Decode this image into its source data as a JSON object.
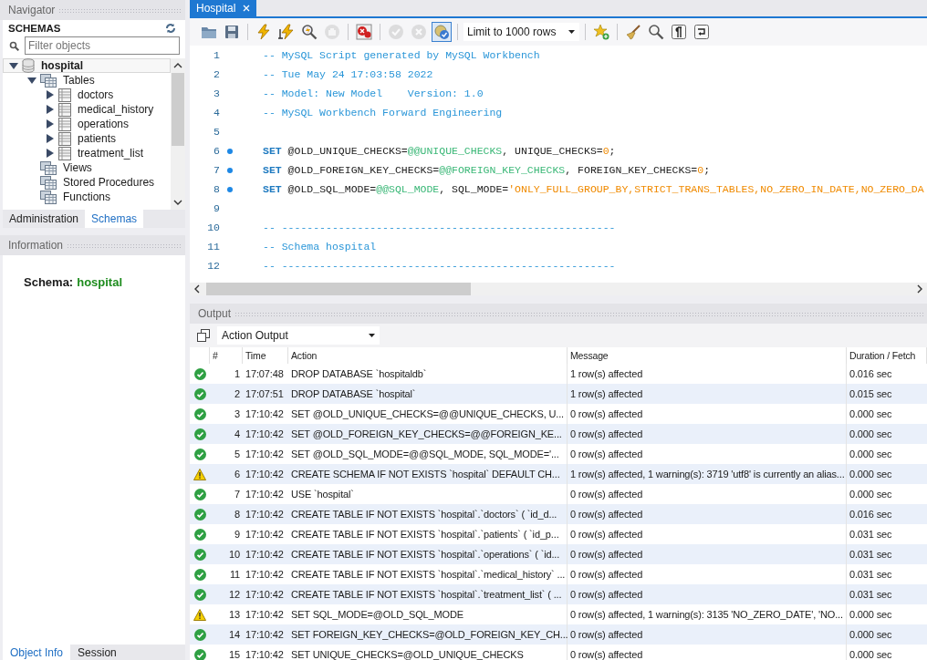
{
  "navigator": {
    "title": "Navigator",
    "section": "SCHEMAS",
    "filter": {
      "placeholder": "Filter objects"
    },
    "tree": [
      {
        "label": "hospital",
        "kind": "database",
        "expanded": true,
        "selected": true,
        "children": [
          {
            "label": "Tables",
            "kind": "folder",
            "expanded": true,
            "selected": false,
            "children": [
              {
                "label": "doctors",
                "kind": "table",
                "expanded": false,
                "selected": false
              },
              {
                "label": "medical_history",
                "kind": "table",
                "expanded": false,
                "selected": false
              },
              {
                "label": "operations",
                "kind": "table",
                "expanded": false,
                "selected": false
              },
              {
                "label": "patients",
                "kind": "table",
                "expanded": false,
                "selected": false
              },
              {
                "label": "treatment_list",
                "kind": "table",
                "expanded": false,
                "selected": false
              }
            ]
          },
          {
            "label": "Views",
            "kind": "folder",
            "selected": false
          },
          {
            "label": "Stored Procedures",
            "kind": "folder",
            "selected": false
          },
          {
            "label": "Functions",
            "kind": "folder",
            "selected": false
          }
        ]
      }
    ],
    "tabs": [
      {
        "label": "Administration",
        "selected": false
      },
      {
        "label": "Schemas",
        "selected": true
      }
    ]
  },
  "information": {
    "title": "Information",
    "label": "Schema:",
    "value": "hospital"
  },
  "bottom_tabs": [
    {
      "label": "Object Info",
      "selected": true
    },
    {
      "label": "Session",
      "selected": false
    }
  ],
  "editor_tab": {
    "label": "Hospital",
    "selected": true
  },
  "toolbar": [
    [
      {
        "kind": "open",
        "disabled": false
      },
      {
        "kind": "save",
        "disabled": false
      }
    ],
    [
      {
        "kind": "execute",
        "disabled": false
      },
      {
        "kind": "execute-current",
        "disabled": false
      },
      {
        "kind": "explain",
        "disabled": false
      },
      {
        "kind": "stop",
        "disabled": true
      }
    ],
    [
      {
        "kind": "error-toggle",
        "disabled": false
      }
    ],
    [
      {
        "kind": "commit",
        "disabled": true
      },
      {
        "kind": "rollback",
        "disabled": true
      },
      {
        "kind": "autocommit",
        "disabled": false,
        "pressed": true
      }
    ],
    [
      {
        "kind": "limit",
        "value": "Limit to 1000 rows"
      }
    ],
    [
      {
        "kind": "snippet",
        "disabled": false
      }
    ],
    [
      {
        "kind": "beautify",
        "disabled": false
      },
      {
        "kind": "find",
        "disabled": false
      },
      {
        "kind": "invisibles",
        "disabled": false
      },
      {
        "kind": "wrap",
        "disabled": false
      }
    ]
  ],
  "code": [
    {
      "number": "1",
      "marker": false,
      "tokens": [
        {
          "kind": "comment",
          "text": "-- MySQL Script generated by MySQL Workbench"
        }
      ]
    },
    {
      "number": "2",
      "marker": false,
      "tokens": [
        {
          "kind": "comment",
          "text": "-- Tue May 24 17:03:58 2022"
        }
      ]
    },
    {
      "number": "3",
      "marker": false,
      "tokens": [
        {
          "kind": "comment",
          "text": "-- Model: New Model    Version: 1.0"
        }
      ]
    },
    {
      "number": "4",
      "marker": false,
      "tokens": [
        {
          "kind": "comment",
          "text": "-- MySQL Workbench Forward Engineering"
        }
      ]
    },
    {
      "number": "5",
      "marker": false
    },
    {
      "number": "6",
      "marker": true,
      "tokens": [
        {
          "kind": "keyword",
          "text": "SET"
        },
        {
          "kind": "plain",
          "text": " @OLD_UNIQUE_CHECKS="
        },
        {
          "kind": "sysvar",
          "text": "@@UNIQUE_CHECKS"
        },
        {
          "kind": "plain",
          "text": ", UNIQUE_CHECKS="
        },
        {
          "kind": "number",
          "text": "0"
        },
        {
          "kind": "plain",
          "text": ";"
        }
      ]
    },
    {
      "number": "7",
      "marker": true,
      "tokens": [
        {
          "kind": "keyword",
          "text": "SET"
        },
        {
          "kind": "plain",
          "text": " @OLD_FOREIGN_KEY_CHECKS="
        },
        {
          "kind": "sysvar",
          "text": "@@FOREIGN_KEY_CHECKS"
        },
        {
          "kind": "plain",
          "text": ", FOREIGN_KEY_CHECKS="
        },
        {
          "kind": "number",
          "text": "0"
        },
        {
          "kind": "plain",
          "text": ";"
        }
      ]
    },
    {
      "number": "8",
      "marker": true,
      "tokens": [
        {
          "kind": "keyword",
          "text": "SET"
        },
        {
          "kind": "plain",
          "text": " @OLD_SQL_MODE="
        },
        {
          "kind": "sysvar",
          "text": "@@SQL_MODE"
        },
        {
          "kind": "plain",
          "text": ", SQL_MODE="
        },
        {
          "kind": "string",
          "text": "'ONLY_FULL_GROUP_BY,STRICT_TRANS_TABLES,NO_ZERO_IN_DATE,NO_ZERO_DA"
        }
      ]
    },
    {
      "number": "9",
      "marker": false
    },
    {
      "number": "10",
      "marker": false,
      "tokens": [
        {
          "kind": "comment",
          "text": "-- -----------------------------------------------------"
        }
      ]
    },
    {
      "number": "11",
      "marker": false,
      "tokens": [
        {
          "kind": "comment",
          "text": "-- Schema hospital"
        }
      ]
    },
    {
      "number": "12",
      "marker": false,
      "tokens": [
        {
          "kind": "comment",
          "text": "-- -----------------------------------------------------"
        }
      ]
    }
  ],
  "output": {
    "title": "Output",
    "mode": "Action Output",
    "columns": [
      "#",
      "Time",
      "Action",
      "Message",
      "Duration / Fetch"
    ],
    "rows": [
      {
        "kind": "ok",
        "number": "1",
        "time": "17:07:48",
        "action": "DROP DATABASE `hospitaldb`",
        "message": "1 row(s) affected",
        "duration": "0.016 sec"
      },
      {
        "kind": "ok",
        "number": "2",
        "time": "17:07:51",
        "action": "DROP DATABASE `hospital`",
        "message": "1 row(s) affected",
        "duration": "0.015 sec"
      },
      {
        "kind": "ok",
        "number": "3",
        "time": "17:10:42",
        "action": "SET @OLD_UNIQUE_CHECKS=@@UNIQUE_CHECKS, U...",
        "message": "0 row(s) affected",
        "duration": "0.000 sec"
      },
      {
        "kind": "ok",
        "number": "4",
        "time": "17:10:42",
        "action": "SET @OLD_FOREIGN_KEY_CHECKS=@@FOREIGN_KE...",
        "message": "0 row(s) affected",
        "duration": "0.000 sec"
      },
      {
        "kind": "ok",
        "number": "5",
        "time": "17:10:42",
        "action": "SET @OLD_SQL_MODE=@@SQL_MODE, SQL_MODE='...",
        "message": "0 row(s) affected",
        "duration": "0.000 sec"
      },
      {
        "kind": "warning",
        "number": "6",
        "time": "17:10:42",
        "action": "CREATE SCHEMA IF NOT EXISTS `hospital` DEFAULT CH...",
        "message": "1 row(s) affected, 1 warning(s): 3719 'utf8' is currently an alias...",
        "duration": "0.000 sec"
      },
      {
        "kind": "ok",
        "number": "7",
        "time": "17:10:42",
        "action": "USE `hospital`",
        "message": "0 row(s) affected",
        "duration": "0.000 sec"
      },
      {
        "kind": "ok",
        "number": "8",
        "time": "17:10:42",
        "action": "CREATE TABLE IF NOT EXISTS `hospital`.`doctors` (   `id_d...",
        "message": "0 row(s) affected",
        "duration": "0.016 sec"
      },
      {
        "kind": "ok",
        "number": "9",
        "time": "17:10:42",
        "action": "CREATE TABLE IF NOT EXISTS `hospital`.`patients` (   `id_p...",
        "message": "0 row(s) affected",
        "duration": "0.031 sec"
      },
      {
        "kind": "ok",
        "number": "10",
        "time": "17:10:42",
        "action": "CREATE TABLE IF NOT EXISTS `hospital`.`operations` (   `id...",
        "message": "0 row(s) affected",
        "duration": "0.031 sec"
      },
      {
        "kind": "ok",
        "number": "11",
        "time": "17:10:42",
        "action": "CREATE TABLE IF NOT EXISTS `hospital`.`medical_history` ...",
        "message": "0 row(s) affected",
        "duration": "0.031 sec"
      },
      {
        "kind": "ok",
        "number": "12",
        "time": "17:10:42",
        "action": "CREATE TABLE IF NOT EXISTS `hospital`.`treatment_list` ( ...",
        "message": "0 row(s) affected",
        "duration": "0.031 sec"
      },
      {
        "kind": "warning",
        "number": "13",
        "time": "17:10:42",
        "action": "SET SQL_MODE=@OLD_SQL_MODE",
        "message": "0 row(s) affected, 1 warning(s): 3135 'NO_ZERO_DATE', 'NO...",
        "duration": "0.000 sec"
      },
      {
        "kind": "ok",
        "number": "14",
        "time": "17:10:42",
        "action": "SET FOREIGN_KEY_CHECKS=@OLD_FOREIGN_KEY_CH...",
        "message": "0 row(s) affected",
        "duration": "0.000 sec"
      },
      {
        "kind": "ok",
        "number": "15",
        "time": "17:10:42",
        "action": "SET UNIQUE_CHECKS=@OLD_UNIQUE_CHECKS",
        "message": "0 row(s) affected",
        "duration": "0.000 sec"
      }
    ]
  }
}
